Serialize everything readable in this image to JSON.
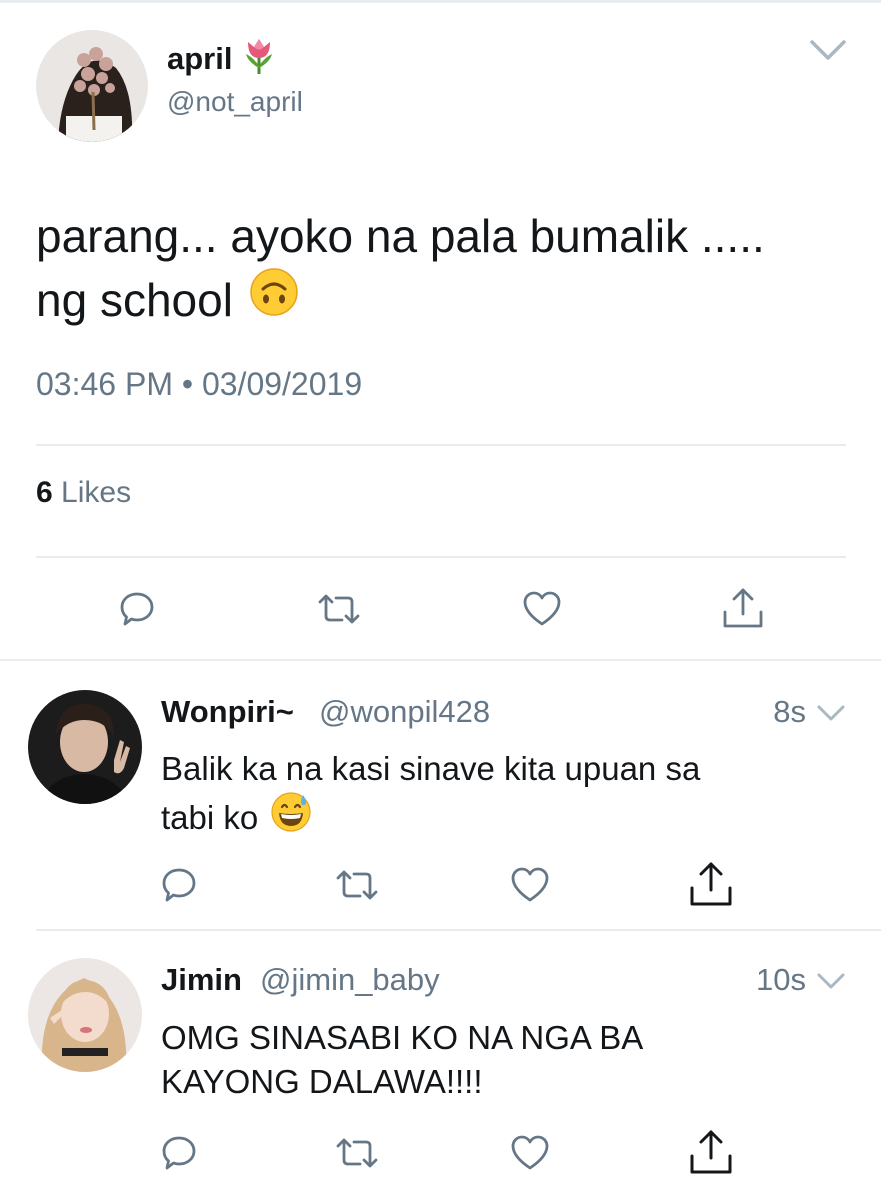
{
  "main_tweet": {
    "display_name": "april",
    "name_emoji": "tulip",
    "handle": "@not_april",
    "text_line1": "parang... ayoko na pala bumalik .....",
    "text_line2": "ng school",
    "text_emoji": "upside-down-face",
    "timestamp": "03:46 PM • 03/09/2019",
    "likes_count": "6",
    "likes_label": "Likes",
    "actions": [
      "reply-icon",
      "retweet-icon",
      "like-icon",
      "share-icon"
    ]
  },
  "replies": [
    {
      "display_name": "Wonpiri~",
      "handle": "@wonpil428",
      "time": "8s",
      "text_line1": "Balik ka na kasi sinave kita upuan sa",
      "text_line2": "tabi ko",
      "text_emoji": "grinning-face-with-sweat"
    },
    {
      "display_name": "Jimin",
      "handle": "@jimin_baby",
      "time": "10s",
      "text_line1": "OMG SINASABI KO NA NGA BA",
      "text_line2": "KAYONG DALAWA!!!!"
    }
  ],
  "colors": {
    "text": "#14171a",
    "secondary": "#657786",
    "divider": "#e6ecf0",
    "icon": "#657786"
  }
}
